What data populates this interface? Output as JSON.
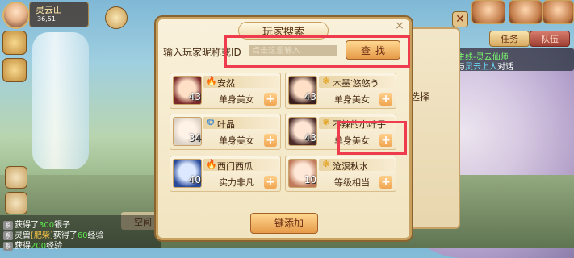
{
  "location": {
    "name": "灵云山",
    "coords": "36,51"
  },
  "quest": {
    "tab_active": "任务",
    "tab_inactive": "队伍",
    "line1_prefix": "主线-",
    "line1_title": "灵云仙师",
    "line2_prefix": "与",
    "line2_npc": "灵云上人",
    "line2_suffix": "对话"
  },
  "back_dialog": {
    "fragment": "选择"
  },
  "dialog": {
    "title": "玩家搜索",
    "close_glyph": "×",
    "search_label": "输入玩家昵称或ID",
    "search_placeholder": "点击这里输入",
    "search_button": "查找",
    "add_all_button": "一键添加"
  },
  "players": [
    {
      "name": "安然",
      "level": "43",
      "tag": "单身美女",
      "icon": "fire-icon",
      "icon_glyph": "🔥",
      "icon_color": "#d9462a",
      "avatar_colors": [
        "#ffe0c6",
        "#7a2a2a"
      ]
    },
    {
      "name": "木墨′悠悠う",
      "level": "43",
      "tag": "单身美女",
      "icon": "wind-icon",
      "icon_glyph": "❃",
      "icon_color": "#e6a21e",
      "avatar_colors": [
        "#ffe0c6",
        "#3a1e1e"
      ]
    },
    {
      "name": "叶晶",
      "level": "34",
      "tag": "单身美女",
      "icon": "water-icon",
      "icon_glyph": "❂",
      "icon_color": "#2a7fd6",
      "avatar_colors": [
        "#fff2e6",
        "#d9cfc4"
      ]
    },
    {
      "name": "不辣的小叶子",
      "level": "43",
      "tag": "单身美女",
      "icon": "wind-icon",
      "icon_glyph": "❃",
      "icon_color": "#e6a21e",
      "avatar_colors": [
        "#ffe6d4",
        "#4a2a2a"
      ]
    },
    {
      "name": "西门西瓜",
      "level": "40",
      "tag": "实力非凡",
      "icon": "fire-icon",
      "icon_glyph": "🔥",
      "icon_color": "#d9462a",
      "avatar_colors": [
        "#dbe8ff",
        "#2a4a9a"
      ]
    },
    {
      "name": "沧溟秋水",
      "level": "10",
      "tag": "等级相当",
      "icon": "wind-icon",
      "icon_glyph": "❃",
      "icon_color": "#e6a21e",
      "avatar_colors": [
        "#ffe8d8",
        "#c07a5a"
      ]
    }
  ],
  "chat": [
    {
      "channel": "系",
      "pre": "获得了",
      "num": "300",
      "post": "银子"
    },
    {
      "channel": "系",
      "pre": "灵兽",
      "name": "[肥柴]",
      "mid": "获得了",
      "num": "60",
      "post": "经验"
    },
    {
      "channel": "系",
      "pre": "获得",
      "num": "200",
      "post": "经验"
    }
  ],
  "space_label": "空间"
}
